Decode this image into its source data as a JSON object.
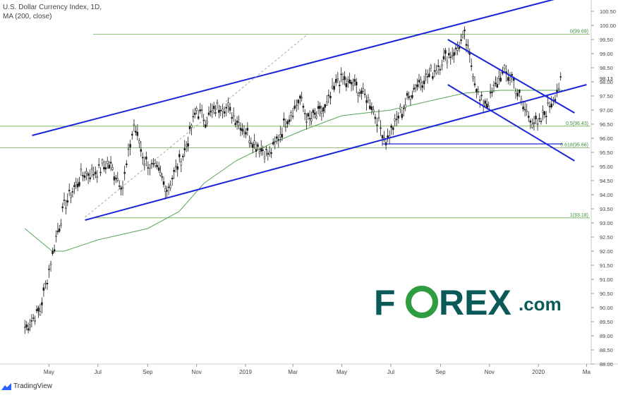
{
  "header": {
    "title": "U.S. Dollar Currency Index, 1D,",
    "indicator": "MA (200, close)"
  },
  "watermark": {
    "brand_left": "F",
    "brand_o": "O",
    "brand_right": "REX",
    "brand_suffix": ".com",
    "color": "#0a5a5a",
    "accent": "#2e9c3f"
  },
  "footer": {
    "provider": "TradingView"
  },
  "chart_data": {
    "type": "line",
    "title": "U.S. Dollar Currency Index, 1D",
    "ylim": [
      88.0,
      100.9
    ],
    "y_ticks": [
      "100.50",
      "100.00",
      "99.50",
      "99.00",
      "98.50",
      "98.00",
      "97.50",
      "97.00",
      "96.50",
      "96.00",
      "95.50",
      "95.00",
      "94.50",
      "94.00",
      "93.50",
      "93.00",
      "92.50",
      "92.00",
      "91.50",
      "91.00",
      "90.50",
      "90.00",
      "89.50",
      "89.00",
      "88.50",
      "88.00"
    ],
    "current_price": "98.13",
    "x_ticks": [
      "May",
      "Jul",
      "Sep",
      "Nov",
      "2019",
      "Mar",
      "May",
      "Jul",
      "Sep",
      "Nov",
      "2020",
      "Ma"
    ],
    "series": [
      {
        "name": "U.S. Dollar Currency Index",
        "color": "#222222",
        "x": [
          "2018-04-01",
          "2018-04-20",
          "2018-05-10",
          "2018-05-20",
          "2018-06-10",
          "2018-06-28",
          "2018-07-15",
          "2018-08-01",
          "2018-08-15",
          "2018-08-28",
          "2018-09-15",
          "2018-09-25",
          "2018-10-15",
          "2018-11-01",
          "2018-11-12",
          "2018-12-01",
          "2018-12-15",
          "2019-01-10",
          "2019-01-31",
          "2019-02-20",
          "2019-03-10",
          "2019-03-20",
          "2019-04-10",
          "2019-04-26",
          "2019-05-15",
          "2019-06-05",
          "2019-06-25",
          "2019-07-15",
          "2019-08-01",
          "2019-08-20",
          "2019-09-05",
          "2019-09-20",
          "2019-10-01",
          "2019-10-20",
          "2019-10-31",
          "2019-11-15",
          "2019-11-29",
          "2019-12-13",
          "2019-12-31",
          "2020-01-15",
          "2020-01-31"
        ],
        "y": [
          89.3,
          89.9,
          92.5,
          93.6,
          94.7,
          94.8,
          95.1,
          94.3,
          96.5,
          95.2,
          94.8,
          94.2,
          95.4,
          97.0,
          96.7,
          97.2,
          96.9,
          95.9,
          95.4,
          96.6,
          97.4,
          96.6,
          97.0,
          98.1,
          97.9,
          97.3,
          95.9,
          97.0,
          97.9,
          98.3,
          98.8,
          99.1,
          99.6,
          97.3,
          97.3,
          98.3,
          98.2,
          97.1,
          96.4,
          97.2,
          98.1
        ]
      },
      {
        "name": "MA (200, close)",
        "color": "#5aa55a",
        "x": [
          "2018-04-01",
          "2018-05-05",
          "2018-05-20",
          "2018-07-01",
          "2018-09-01",
          "2018-10-10",
          "2018-11-10",
          "2018-12-20",
          "2019-02-01",
          "2019-03-15",
          "2019-05-01",
          "2019-07-01",
          "2019-08-15",
          "2019-10-01",
          "2019-11-15",
          "2020-01-31"
        ],
        "y": [
          92.8,
          92.0,
          92.0,
          92.4,
          92.8,
          93.4,
          94.4,
          95.2,
          95.8,
          96.3,
          96.8,
          97.0,
          97.3,
          97.6,
          97.7,
          97.7
        ]
      }
    ],
    "trendlines": [
      {
        "label": "upper channel",
        "x": [
          "2018-04-10",
          "2020-01-31"
        ],
        "y": [
          96.1,
          101.0
        ],
        "color": "#1a24d8"
      },
      {
        "label": "lower channel",
        "x": [
          "2018-06-15",
          "2020-03-01"
        ],
        "y": [
          93.1,
          97.9
        ],
        "color": "#1a24d8"
      },
      {
        "label": "down channel top",
        "x": [
          "2019-09-10",
          "2020-02-15"
        ],
        "y": [
          99.5,
          96.9
        ],
        "color": "#1a24d8"
      },
      {
        "label": "down channel bottom",
        "x": [
          "2019-09-10",
          "2020-02-15"
        ],
        "y": [
          97.9,
          95.2
        ],
        "color": "#1a24d8"
      },
      {
        "label": "support",
        "x": [
          "2019-06-20",
          "2020-01-31"
        ],
        "y": [
          95.8,
          95.8
        ],
        "color": "#1a24d8"
      },
      {
        "label": "dashed",
        "x": [
          "2018-06-15",
          "2019-03-20"
        ],
        "y": [
          93.2,
          99.7
        ],
        "color": "#8a9a6a"
      }
    ],
    "fib_levels": [
      {
        "label": "0(99.69)",
        "value": 99.69
      },
      {
        "label": "0.5(96.43)",
        "value": 96.43
      },
      {
        "label": "0.618(95.66)",
        "value": 95.66
      },
      {
        "label": "1(93.18)",
        "value": 93.18
      }
    ]
  }
}
